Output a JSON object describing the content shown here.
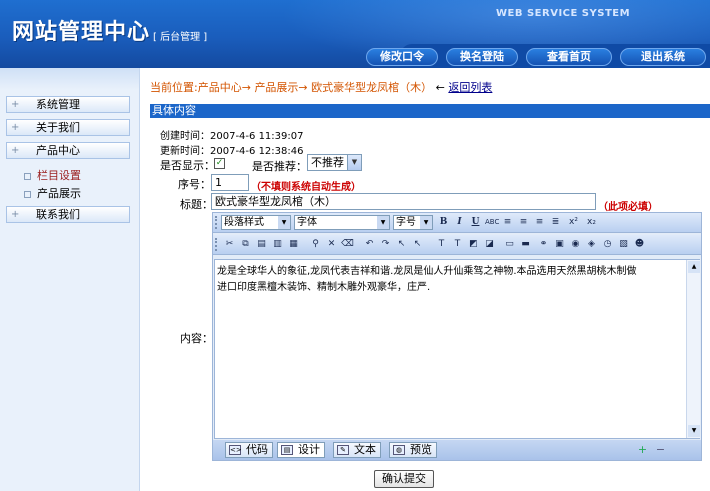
{
  "header": {
    "site_title": "网站管理中心",
    "site_subtitle": "[ 后台管理 ]",
    "service_label": "WEB SERVICE SYSTEM",
    "nav": [
      "修改口令",
      "换名登陆",
      "查看首页",
      "退出系统"
    ]
  },
  "sidebar": {
    "items": [
      {
        "label": "系统管理"
      },
      {
        "label": "关于我们"
      },
      {
        "label": "产品中心"
      },
      {
        "label": "联系我们"
      }
    ],
    "sub_items": [
      {
        "label": "栏目设置",
        "active": true
      },
      {
        "label": "产品展示",
        "active": false
      }
    ]
  },
  "breadcrumb": {
    "prefix": "当前位置:产品中心→",
    "step2": "产品展示→",
    "step3": "欧式豪华型龙凤棺（木）",
    "arrow": "←",
    "back": "返回列表"
  },
  "section": {
    "title": "具体内容"
  },
  "meta": {
    "created_label": "创建时间：",
    "created_value": "2007-4-6 11:39:07",
    "updated_label": "更新时间：",
    "updated_value": "2007-4-6 12:38:46"
  },
  "form": {
    "show_label": "是否显示：",
    "show_checked": "✓",
    "recommend_label": "是否推荐：",
    "recommend_value": "不推荐",
    "order_label": "序号：",
    "order_value": "1",
    "order_hint": "（不填则系统自动生成）",
    "title_label": "标题：",
    "title_value": "欧式豪华型龙凤棺（木）",
    "title_hint": "（此项必填）",
    "content_label": "内容：",
    "submit": "确认提交"
  },
  "editor": {
    "paragraph_style": "段落样式",
    "font": "字体",
    "font_size": "字号",
    "content_line1": "龙是全球华人的象征,龙凤代表吉祥和谐.龙凤是仙人升仙乘驾之神物.本品选用天然黑胡桃木制做",
    "content_line2": "进口印度黑檀木装饰、精制木雕外观豪华，庄严.",
    "modes": [
      "代码",
      "设计",
      "文本",
      "预览"
    ]
  }
}
